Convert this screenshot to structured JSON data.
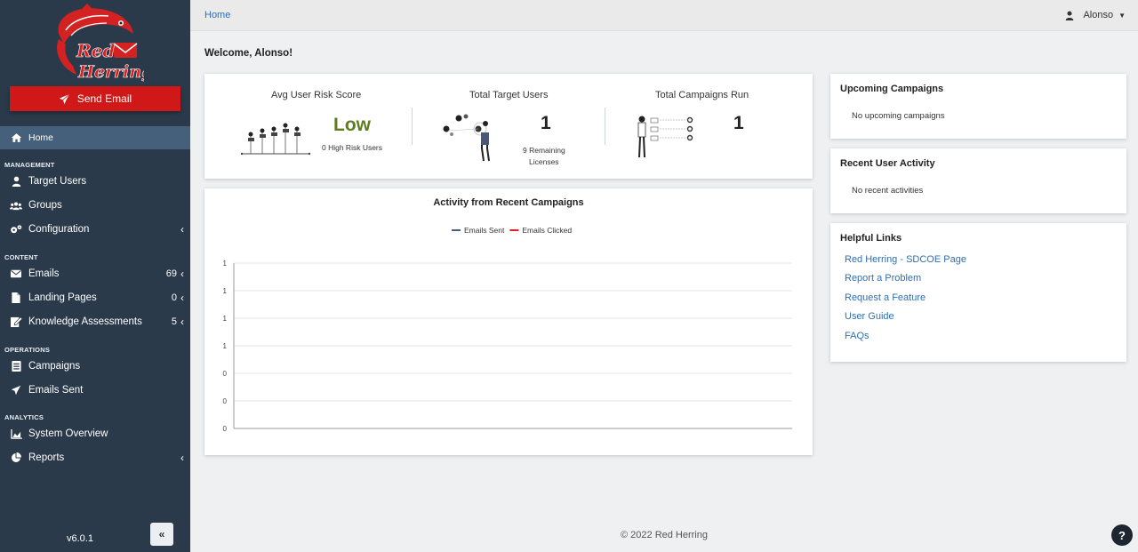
{
  "sidebar": {
    "logo_line1": "Red",
    "logo_line2": "Herring",
    "send_email_label": "Send Email",
    "home_label": "Home",
    "sections": {
      "management": "MANAGEMENT",
      "content": "CONTENT",
      "operations": "OPERATIONS",
      "analytics": "ANALYTICS"
    },
    "items": {
      "target_users": "Target Users",
      "groups": "Groups",
      "configuration": "Configuration",
      "emails": "Emails",
      "emails_count": "69",
      "landing_pages": "Landing Pages",
      "landing_pages_count": "0",
      "knowledge_assessments": "Knowledge Assessments",
      "knowledge_assessments_count": "5",
      "campaigns": "Campaigns",
      "emails_sent": "Emails Sent",
      "system_overview": "System Overview",
      "reports": "Reports"
    },
    "version": "v6.0.1"
  },
  "topbar": {
    "breadcrumb": "Home",
    "user_name": "Alonso"
  },
  "welcome": "Welcome, Alonso!",
  "stats": {
    "risk_title": "Avg User Risk Score",
    "risk_value": "Low",
    "risk_sub": "0 High Risk Users",
    "users_title": "Total Target Users",
    "users_value": "1",
    "users_sub_1": "9 Remaining",
    "users_sub_2": "Licenses",
    "campaigns_title": "Total Campaigns Run",
    "campaigns_value": "1"
  },
  "chart_data": {
    "type": "line",
    "title": "Activity from Recent Campaigns",
    "legend_position": "top",
    "y_tick_labels": [
      "1",
      "1",
      "1",
      "1",
      "0",
      "0",
      "0"
    ],
    "series": [
      {
        "name": "Emails Sent",
        "color": "#4a5f78",
        "values": []
      },
      {
        "name": "Emails Clicked",
        "color": "#e02020",
        "values": []
      }
    ],
    "grid": true
  },
  "upcoming": {
    "title": "Upcoming Campaigns",
    "empty_text": "No upcoming campaigns"
  },
  "activity": {
    "title": "Recent User Activity",
    "empty_text": "No recent activities"
  },
  "links": {
    "title": "Helpful Links",
    "items": [
      "Red Herring - SDCOE Page",
      "Report a Problem",
      "Request a Feature",
      "User Guide",
      "FAQs"
    ]
  },
  "footer": "© 2022 Red Herring",
  "colors": {
    "sidebar_bg": "#2b3a4a",
    "accent_red": "#d01818",
    "link_blue": "#2d6fb5",
    "risk_green": "#5f7d1e"
  }
}
